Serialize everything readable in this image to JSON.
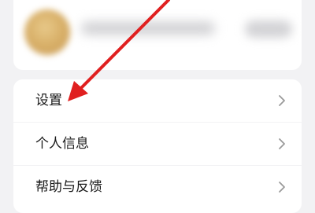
{
  "menu": {
    "items": [
      {
        "label": "设置",
        "icon": "chevron-right-icon"
      },
      {
        "label": "个人信息",
        "icon": "chevron-right-icon"
      },
      {
        "label": "帮助与反馈",
        "icon": "chevron-right-icon"
      }
    ]
  },
  "annotation": {
    "color": "#e02020",
    "points_to": "设置"
  },
  "colors": {
    "background": "#f2f2f4",
    "card": "#ffffff",
    "text": "#1a1a1a",
    "chevron": "#9a9a9a"
  }
}
